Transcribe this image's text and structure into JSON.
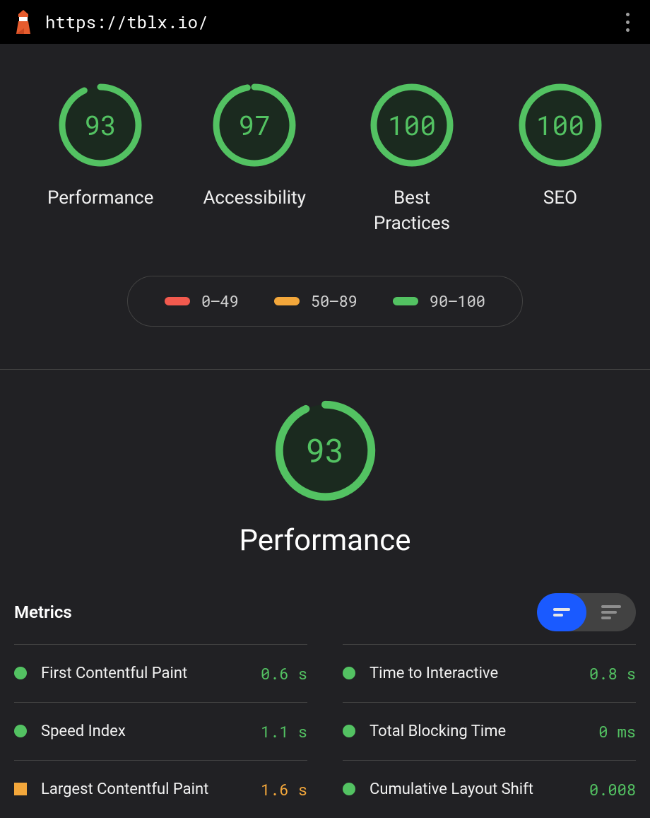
{
  "header": {
    "url": "https://tblx.io/"
  },
  "colors": {
    "good": "#53c262",
    "average": "#f3a73b",
    "poor": "#f25a4e",
    "good_bg": "#1b2a1f"
  },
  "scores": [
    {
      "label": "Performance",
      "value": 93
    },
    {
      "label": "Accessibility",
      "value": 97
    },
    {
      "label": "Best Practices",
      "value": 100
    },
    {
      "label": "SEO",
      "value": 100
    }
  ],
  "legend": [
    {
      "range": "0–49",
      "color": "#f25a4e"
    },
    {
      "range": "50–89",
      "color": "#f3a73b"
    },
    {
      "range": "90–100",
      "color": "#53c262"
    }
  ],
  "detail": {
    "title": "Performance",
    "score": 93,
    "metrics_heading": "Metrics",
    "metrics": [
      {
        "name": "First Contentful Paint",
        "value": "0.6 s",
        "status": "good"
      },
      {
        "name": "Time to Interactive",
        "value": "0.8 s",
        "status": "good"
      },
      {
        "name": "Speed Index",
        "value": "1.1 s",
        "status": "good"
      },
      {
        "name": "Total Blocking Time",
        "value": "0 ms",
        "status": "good"
      },
      {
        "name": "Largest Contentful Paint",
        "value": "1.6 s",
        "status": "average"
      },
      {
        "name": "Cumulative Layout Shift",
        "value": "0.008",
        "status": "good"
      }
    ]
  }
}
